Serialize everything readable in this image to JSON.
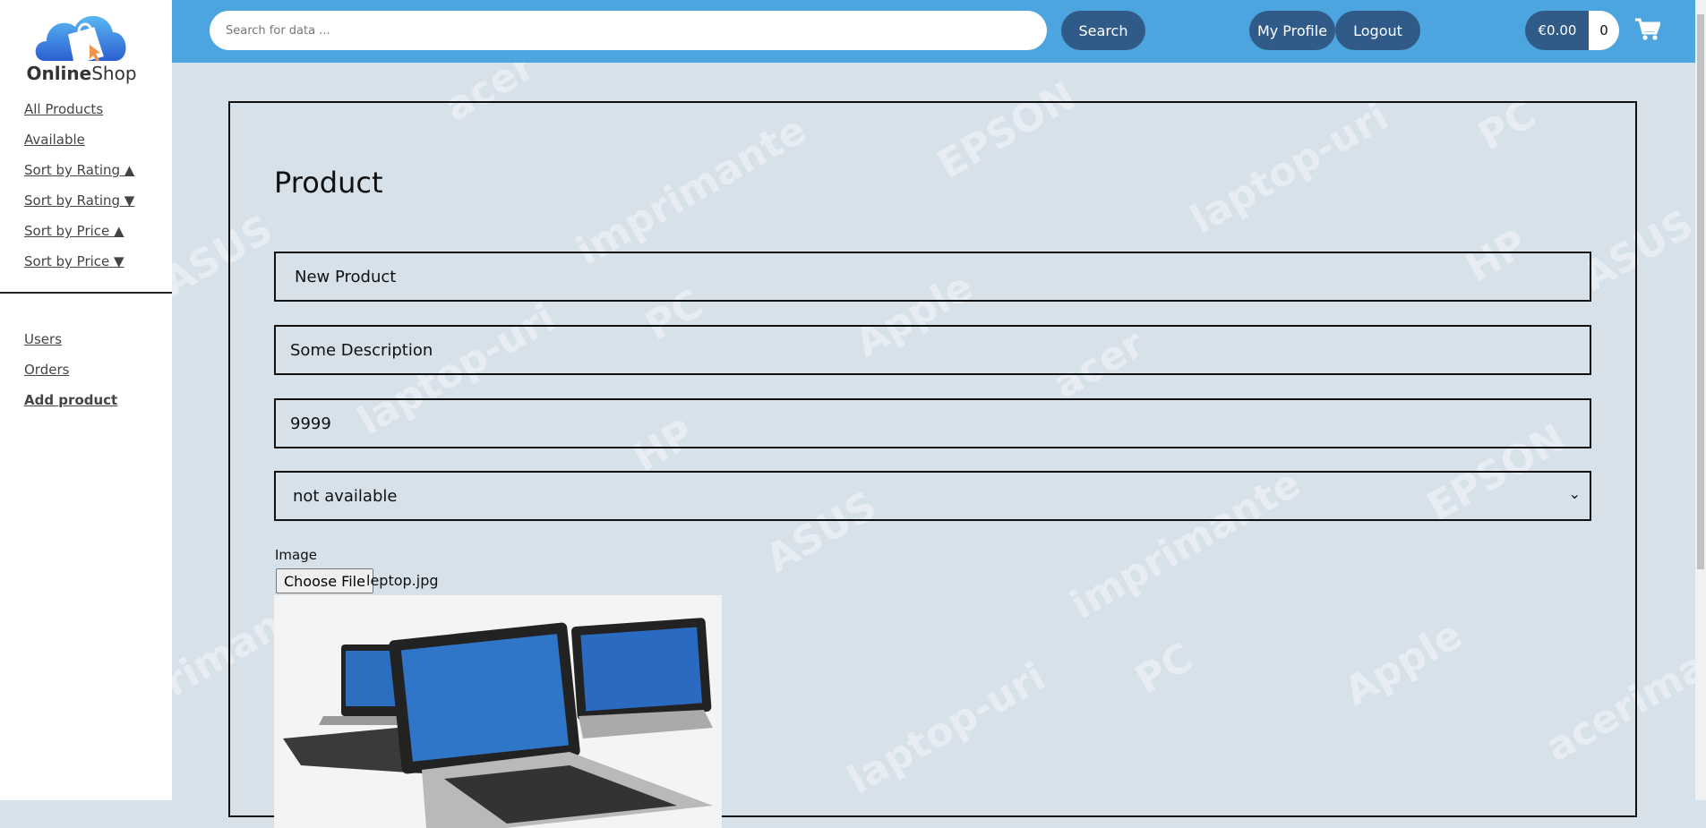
{
  "brand": {
    "name_bold": "Online",
    "name_rest": "Shop"
  },
  "header": {
    "search_placeholder": "Search for data ...",
    "search_label": "Search",
    "profile_label": "My Profile",
    "logout_label": "Logout",
    "cart_total": "€0.00",
    "cart_count": "0"
  },
  "sidebar": {
    "filters": [
      "All Products",
      "Available",
      "Sort by Rating ▲",
      "Sort by Rating ▼",
      "Sort by Price ▲",
      "Sort by Price ▼"
    ],
    "admin": [
      "Users",
      "Orders",
      "Add product"
    ]
  },
  "form": {
    "title": "Product",
    "name": "New Product",
    "description": "Some Description",
    "price": "9999",
    "availability": "not available",
    "image_label": "Image",
    "choose_file_label": "Choose File",
    "file_name": "leptop.jpg"
  },
  "watermark": [
    "acer",
    "EPSON",
    "imprimante",
    "laptop-uri",
    "PC",
    "ASUS",
    "HP",
    "ASUS",
    "Apple",
    "PC",
    "laptop-uri",
    "acer",
    "HP",
    "EPSON",
    "imprimante",
    "ASUS",
    "PC",
    "Apple",
    "laptop-uri",
    "imprimante",
    "acerima"
  ],
  "colors": {
    "header": "#4ca5de",
    "button": "#305a88",
    "background": "#d6e1ea"
  }
}
